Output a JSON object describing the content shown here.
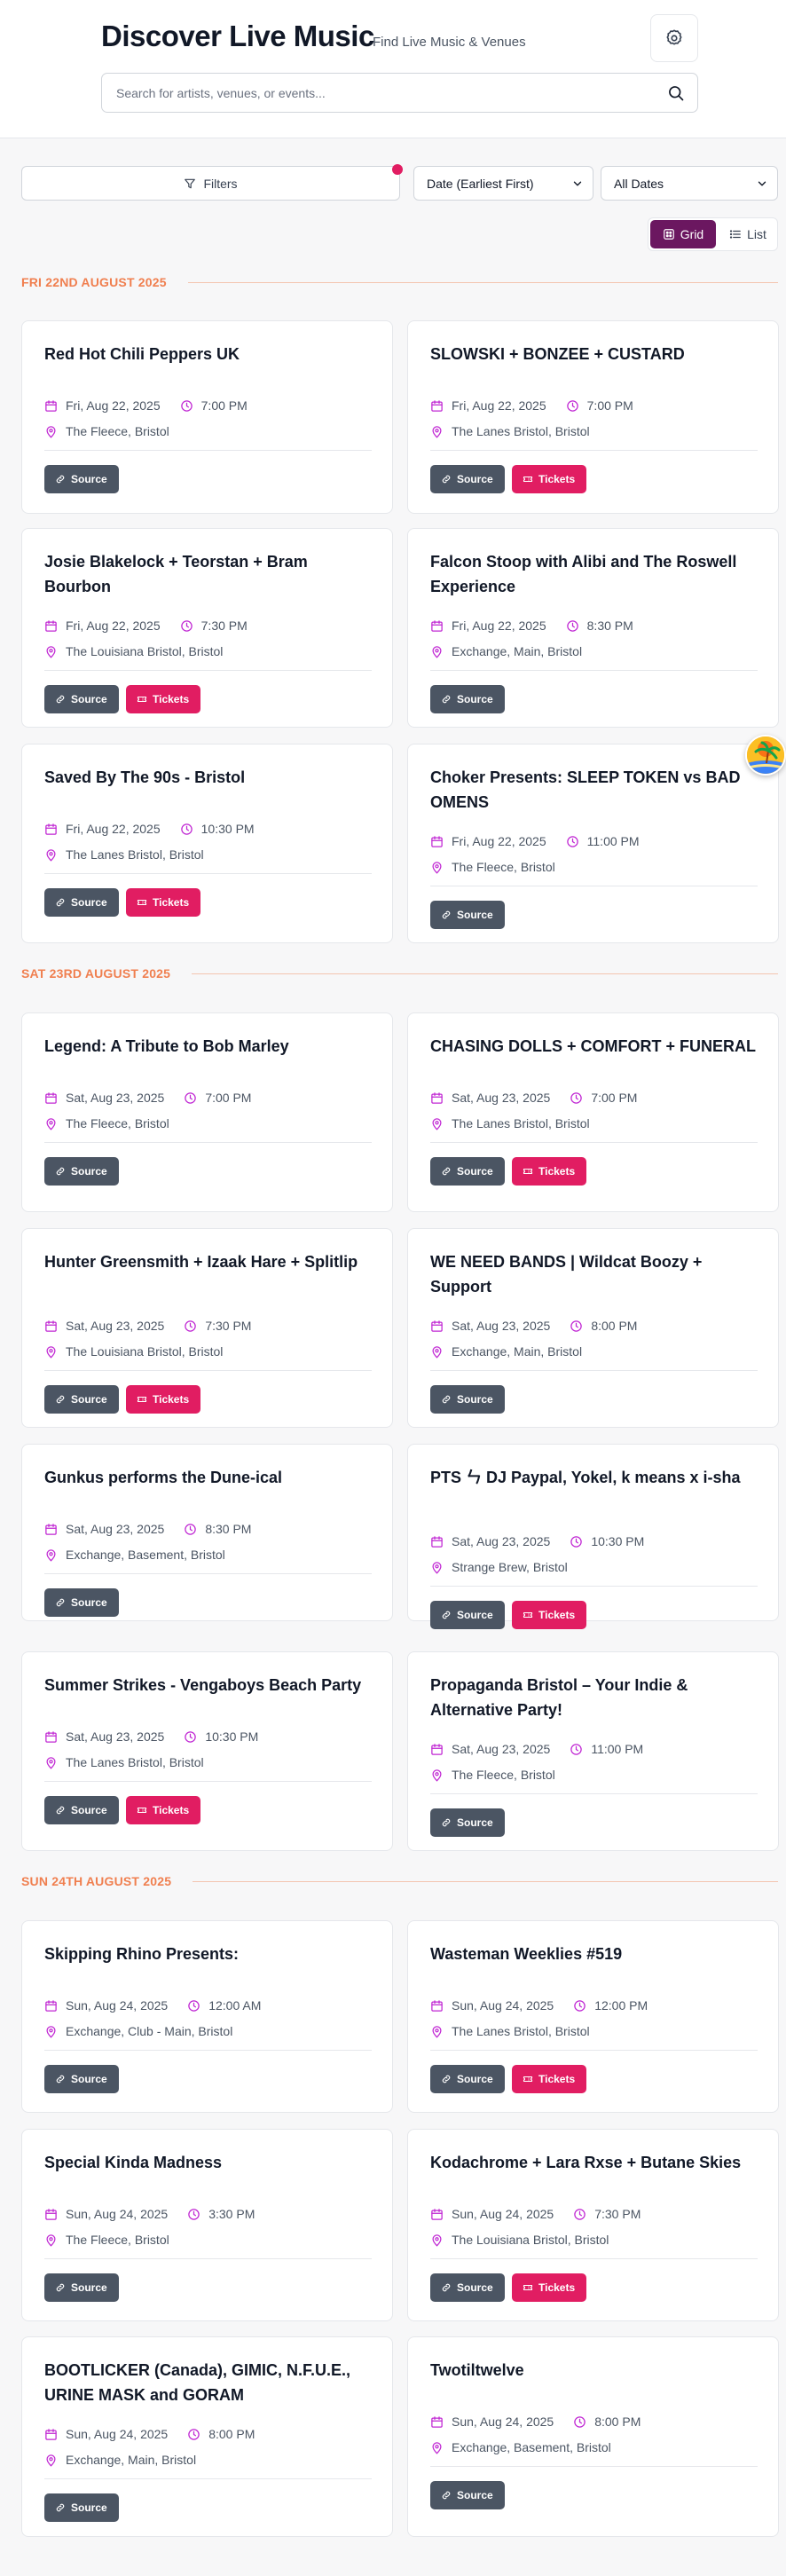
{
  "header": {
    "title": "Discover Live Music",
    "subtitle": "Find Live Music & Venues",
    "settings_icon": "settings-icon"
  },
  "search": {
    "placeholder": "Search for artists, venues, or events...",
    "value": ""
  },
  "toolbar": {
    "filters_label": "Filters",
    "sort_value": "Date (Earliest First)",
    "date_value": "All Dates",
    "grid_label": "Grid",
    "list_label": "List",
    "active_view": "grid"
  },
  "colors": {
    "accent": "#6b1760",
    "tickets": "#e11d62",
    "source": "#4b5563",
    "date_heading": "#f07f4f",
    "icon": "#c026d3"
  },
  "sections": [
    {
      "heading": "FRI 22ND AUGUST 2025",
      "events": [
        {
          "title": "Red Hot Chili Peppers UK",
          "date": "Fri, Aug 22, 2025",
          "time": "7:00 PM",
          "venue": "The Fleece, Bristol",
          "source_label": "Source",
          "tickets_label": ""
        },
        {
          "title": "SLOWSKI + BONZEE + CUSTARD",
          "date": "Fri, Aug 22, 2025",
          "time": "7:00 PM",
          "venue": "The Lanes Bristol, Bristol",
          "source_label": "Source",
          "tickets_label": "Tickets"
        },
        {
          "title": "Josie Blakelock + Teorstan + Bram Bourbon",
          "date": "Fri, Aug 22, 2025",
          "time": "7:30 PM",
          "venue": "The Louisiana Bristol, Bristol",
          "source_label": "Source",
          "tickets_label": "Tickets"
        },
        {
          "title": "Falcon Stoop with Alibi and The Roswell Experience",
          "date": "Fri, Aug 22, 2025",
          "time": "8:30 PM",
          "venue": "Exchange, Main, Bristol",
          "source_label": "Source",
          "tickets_label": ""
        },
        {
          "title": "Saved By The 90s - Bristol",
          "date": "Fri, Aug 22, 2025",
          "time": "10:30 PM",
          "venue": "The Lanes Bristol, Bristol",
          "source_label": "Source",
          "tickets_label": "Tickets"
        },
        {
          "title": "Choker Presents: SLEEP TOKEN vs BAD OMENS",
          "date": "Fri, Aug 22, 2025",
          "time": "11:00 PM",
          "venue": "The Fleece, Bristol",
          "source_label": "Source",
          "tickets_label": ""
        }
      ]
    },
    {
      "heading": "SAT 23RD AUGUST 2025",
      "events": [
        {
          "title": "Legend: A Tribute to Bob Marley",
          "date": "Sat, Aug 23, 2025",
          "time": "7:00 PM",
          "venue": "The Fleece, Bristol",
          "source_label": "Source",
          "tickets_label": ""
        },
        {
          "title": "CHASING DOLLS + COMFORT + FUNERAL",
          "date": "Sat, Aug 23, 2025",
          "time": "7:00 PM",
          "venue": "The Lanes Bristol, Bristol",
          "source_label": "Source",
          "tickets_label": "Tickets"
        },
        {
          "title": "Hunter Greensmith + Izaak Hare + Splitlip",
          "date": "Sat, Aug 23, 2025",
          "time": "7:30 PM",
          "venue": "The Louisiana Bristol, Bristol",
          "source_label": "Source",
          "tickets_label": "Tickets"
        },
        {
          "title": "WE NEED BANDS | Wildcat Boozy + Support",
          "date": "Sat, Aug 23, 2025",
          "time": "8:00 PM",
          "venue": "Exchange, Main, Bristol",
          "source_label": "Source",
          "tickets_label": ""
        },
        {
          "title": "Gunkus performs the Dune-ical",
          "date": "Sat, Aug 23, 2025",
          "time": "8:30 PM",
          "venue": "Exchange, Basement, Bristol",
          "source_label": "Source",
          "tickets_label": ""
        },
        {
          "title": "PTS ㄣ DJ Paypal, Yokel, k means x i-sha",
          "date": "Sat, Aug 23, 2025",
          "time": "10:30 PM",
          "venue": "Strange Brew, Bristol",
          "source_label": "Source",
          "tickets_label": "Tickets"
        },
        {
          "title": "Summer Strikes - Vengaboys Beach Party",
          "date": "Sat, Aug 23, 2025",
          "time": "10:30 PM",
          "venue": "The Lanes Bristol, Bristol",
          "source_label": "Source",
          "tickets_label": "Tickets"
        },
        {
          "title": "Propaganda Bristol – Your Indie & Alternative Party!",
          "date": "Sat, Aug 23, 2025",
          "time": "11:00 PM",
          "venue": "The Fleece, Bristol",
          "source_label": "Source",
          "tickets_label": ""
        }
      ]
    },
    {
      "heading": "SUN 24TH AUGUST 2025",
      "events": [
        {
          "title": "Skipping Rhino Presents:",
          "date": "Sun, Aug 24, 2025",
          "time": "12:00 AM",
          "venue": "Exchange, Club - Main, Bristol",
          "source_label": "Source",
          "tickets_label": ""
        },
        {
          "title": "Wasteman Weeklies #519",
          "date": "Sun, Aug 24, 2025",
          "time": "12:00 PM",
          "venue": "The Lanes Bristol, Bristol",
          "source_label": "Source",
          "tickets_label": "Tickets"
        },
        {
          "title": "Special Kinda Madness",
          "date": "Sun, Aug 24, 2025",
          "time": "3:30 PM",
          "venue": "The Fleece, Bristol",
          "source_label": "Source",
          "tickets_label": ""
        },
        {
          "title": "Kodachrome + Lara Rxse + Butane Skies",
          "date": "Sun, Aug 24, 2025",
          "time": "7:30 PM",
          "venue": "The Louisiana Bristol, Bristol",
          "source_label": "Source",
          "tickets_label": "Tickets"
        },
        {
          "title": "BOOTLICKER (Canada), GIMIC, N.F.U.E., URINE MASK and GORAM",
          "date": "Sun, Aug 24, 2025",
          "time": "8:00 PM",
          "venue": "Exchange, Main, Bristol",
          "source_label": "Source",
          "tickets_label": ""
        },
        {
          "title": "Twotiltwelve",
          "date": "Sun, Aug 24, 2025",
          "time": "8:00 PM",
          "venue": "Exchange, Basement, Bristol",
          "source_label": "Source",
          "tickets_label": ""
        }
      ]
    }
  ]
}
